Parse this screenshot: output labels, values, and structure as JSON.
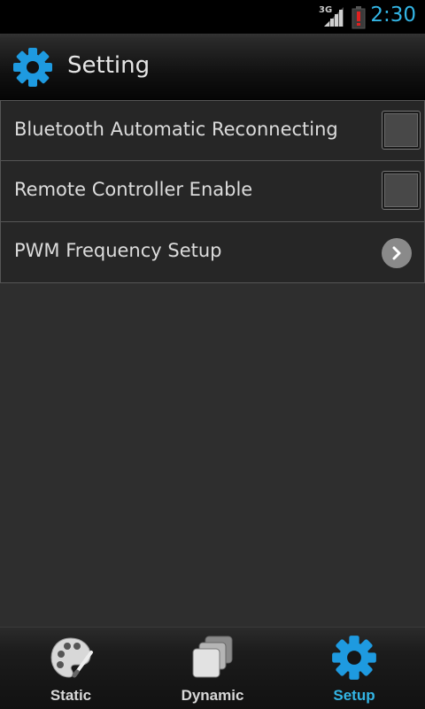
{
  "status_bar": {
    "network": "3G",
    "time": "2:30",
    "icons": [
      "signal-icon",
      "battery-alert-icon"
    ]
  },
  "action_bar": {
    "title": "Setting",
    "icon": "gear-icon"
  },
  "preferences": [
    {
      "label": "Bluetooth Automatic Reconnecting",
      "widget": "checkbox",
      "checked": false
    },
    {
      "label": "Remote Controller Enable",
      "widget": "checkbox",
      "checked": false
    },
    {
      "label": "PWM Frequency Setup",
      "widget": "chevron-right-icon"
    }
  ],
  "tabs": [
    {
      "label": "Static",
      "icon": "palette-icon",
      "active": false
    },
    {
      "label": "Dynamic",
      "icon": "stacked-pages-icon",
      "active": false
    },
    {
      "label": "Setup",
      "icon": "gear-icon",
      "active": true
    }
  ],
  "colors": {
    "accent": "#33b5e5",
    "background": "#2e2e2e"
  }
}
